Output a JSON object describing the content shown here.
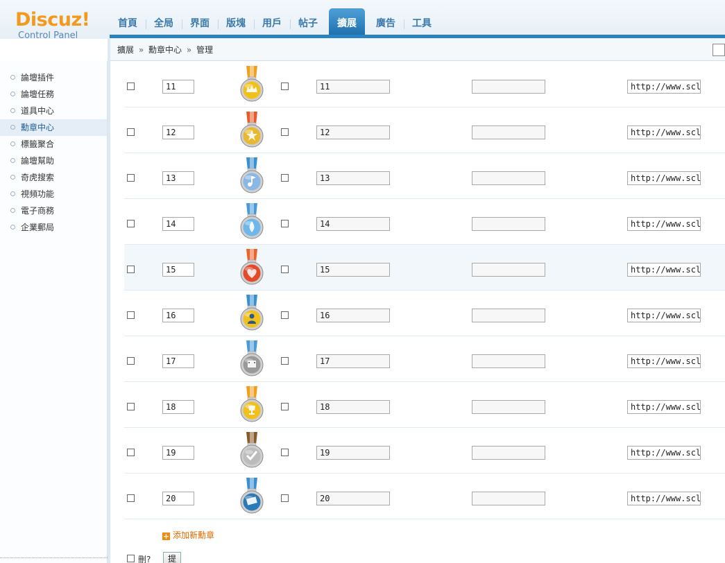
{
  "logo": {
    "main": "Discuz!",
    "sub": "Control Panel"
  },
  "nav": {
    "items": [
      {
        "label": "首頁"
      },
      {
        "label": "全局"
      },
      {
        "label": "界面"
      },
      {
        "label": "版塊"
      },
      {
        "label": "用戶"
      },
      {
        "label": "帖子"
      },
      {
        "label": "擴展",
        "active": true
      },
      {
        "label": "廣告"
      },
      {
        "label": "工具"
      }
    ]
  },
  "breadcrumb": {
    "part1": "擴展",
    "sep": "»",
    "part2": "勳章中心",
    "part3": "管理"
  },
  "sidebar": {
    "items": [
      {
        "label": "論壇插件"
      },
      {
        "label": "論壇任務"
      },
      {
        "label": "道具中心"
      },
      {
        "label": "勳章中心",
        "active": true
      },
      {
        "label": "標籤聚合"
      },
      {
        "label": "論壇幫助"
      },
      {
        "label": "奇虎搜索"
      },
      {
        "label": "視頻功能"
      },
      {
        "label": "電子商務"
      },
      {
        "label": "企業郵局"
      }
    ]
  },
  "medals": {
    "rows": [
      {
        "order": "11",
        "name": "11",
        "desc": "",
        "url": "http://www.sclub",
        "ribbon": "#f0a020",
        "disc": "#f2c01a",
        "icon": "crown-icon"
      },
      {
        "order": "12",
        "name": "12",
        "desc": "",
        "url": "http://www.sclub",
        "ribbon": "#e85a2a",
        "disc": "#e8b830",
        "icon": "star-icon"
      },
      {
        "order": "13",
        "name": "13",
        "desc": "",
        "url": "http://www.sclub",
        "ribbon": "#3a8fd0",
        "disc": "#8ab8e6",
        "icon": "music-icon"
      },
      {
        "order": "14",
        "name": "14",
        "desc": "",
        "url": "http://www.sclub",
        "ribbon": "#4a9ad8",
        "disc": "#6fb7ea",
        "icon": "water-drop-icon"
      },
      {
        "order": "15",
        "name": "15",
        "desc": "",
        "url": "http://www.sclub",
        "ribbon": "#e8642a",
        "disc": "#e24a2a",
        "icon": "heart-icon"
      },
      {
        "order": "16",
        "name": "16",
        "desc": "",
        "url": "http://www.sclub",
        "ribbon": "#3a8fd0",
        "disc": "#f2c01a",
        "icon": "person-icon"
      },
      {
        "order": "17",
        "name": "17",
        "desc": "",
        "url": "http://www.sclub",
        "ribbon": "#4a9ad8",
        "disc": "#9a9a9a",
        "icon": "film-icon"
      },
      {
        "order": "18",
        "name": "18",
        "desc": "",
        "url": "http://www.sclub",
        "ribbon": "#f0a020",
        "disc": "#f2c01a",
        "icon": "trophy-icon"
      },
      {
        "order": "19",
        "name": "19",
        "desc": "",
        "url": "http://www.sclub",
        "ribbon": "#8a5a2a",
        "disc": "#bcbcbc",
        "icon": "check-icon"
      },
      {
        "order": "20",
        "name": "20",
        "desc": "",
        "url": "http://www.sclub",
        "ribbon": "#3a8fd0",
        "disc": "#2a7ab8",
        "icon": "book-icon"
      }
    ]
  },
  "actions": {
    "add_label": "添加新勳章",
    "delete_label": "刪?",
    "submit_label": "提交"
  }
}
